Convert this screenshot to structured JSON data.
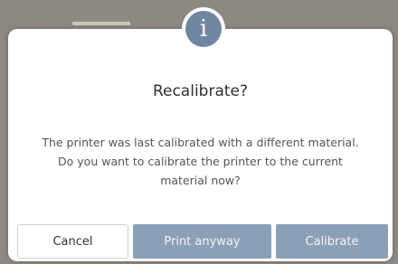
{
  "colors": {
    "backdrop": "#8e8882",
    "dialog_background": "#ffffff",
    "info_icon": "#6f87a1",
    "primary_button": "#8aa0b6",
    "title_text": "#2f2f2f",
    "body_text": "#555555"
  },
  "dialog": {
    "icon": "info-icon",
    "icon_glyph": "i",
    "title": "Recalibrate?",
    "message_lines": [
      "The printer was last calibrated with a different material.",
      "Do you want to calibrate the printer to the current",
      "material now?"
    ],
    "buttons": {
      "cancel": "Cancel",
      "print_anyway": "Print anyway",
      "calibrate": "Calibrate"
    }
  }
}
